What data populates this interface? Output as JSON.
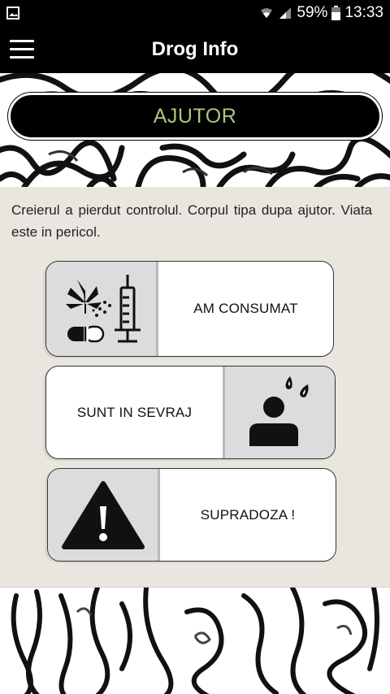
{
  "status_bar": {
    "battery": "59%",
    "time": "13:33"
  },
  "app_bar": {
    "title": "Drog Info"
  },
  "banner": {
    "label": "AJUTOR"
  },
  "intro": {
    "text": "Creierul a pierdut controlul. Corpul tipa dupa ajutor. Viata este in pericol."
  },
  "cards": [
    {
      "label": "AM CONSUMAT",
      "icon": "drugs-syringe-icon"
    },
    {
      "label": "SUNT IN SEVRAJ",
      "icon": "sweating-person-icon"
    },
    {
      "label": "SUPRADOZA !",
      "icon": "warning-triangle-icon"
    }
  ],
  "colors": {
    "banner_text": "#a8c97a",
    "background": "#e8e6df",
    "bar": "#000000"
  }
}
